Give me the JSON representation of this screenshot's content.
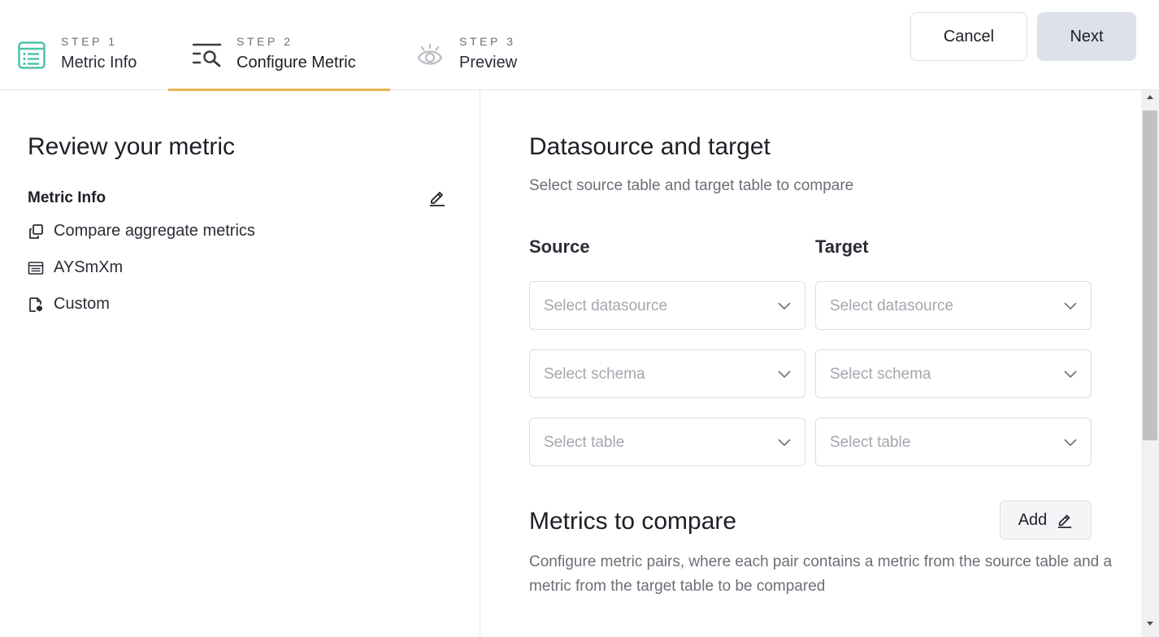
{
  "header": {
    "steps": [
      {
        "number": "STEP 1",
        "title": "Metric Info",
        "icon": "list-icon"
      },
      {
        "number": "STEP 2",
        "title": "Configure Metric",
        "icon": "search-filter-icon"
      },
      {
        "number": "STEP 3",
        "title": "Preview",
        "icon": "eye-icon"
      }
    ],
    "active_step": 2,
    "cancel_label": "Cancel",
    "next_label": "Next"
  },
  "review": {
    "title": "Review your metric",
    "metric_info_heading": "Metric Info",
    "items": [
      {
        "icon": "copy-icon",
        "text": "Compare aggregate metrics"
      },
      {
        "icon": "table-icon",
        "text": "AYSmXm"
      },
      {
        "icon": "file-badge-icon",
        "text": "Custom"
      }
    ]
  },
  "datasource": {
    "title": "Datasource and target",
    "description": "Select source table and target table to compare",
    "source_heading": "Source",
    "target_heading": "Target",
    "source": {
      "datasource_placeholder": "Select datasource",
      "schema_placeholder": "Select schema",
      "table_placeholder": "Select table"
    },
    "target": {
      "datasource_placeholder": "Select datasource",
      "schema_placeholder": "Select schema",
      "table_placeholder": "Select table"
    }
  },
  "metrics": {
    "title": "Metrics to compare",
    "add_label": "Add",
    "description": "Configure metric pairs, where each pair contains a metric from the source table and a metric from the target table to be compared"
  },
  "colors": {
    "accent_underline": "#e8b74f",
    "step1_icon": "#4fc3a9",
    "next_button_bg": "#dde1ea"
  }
}
